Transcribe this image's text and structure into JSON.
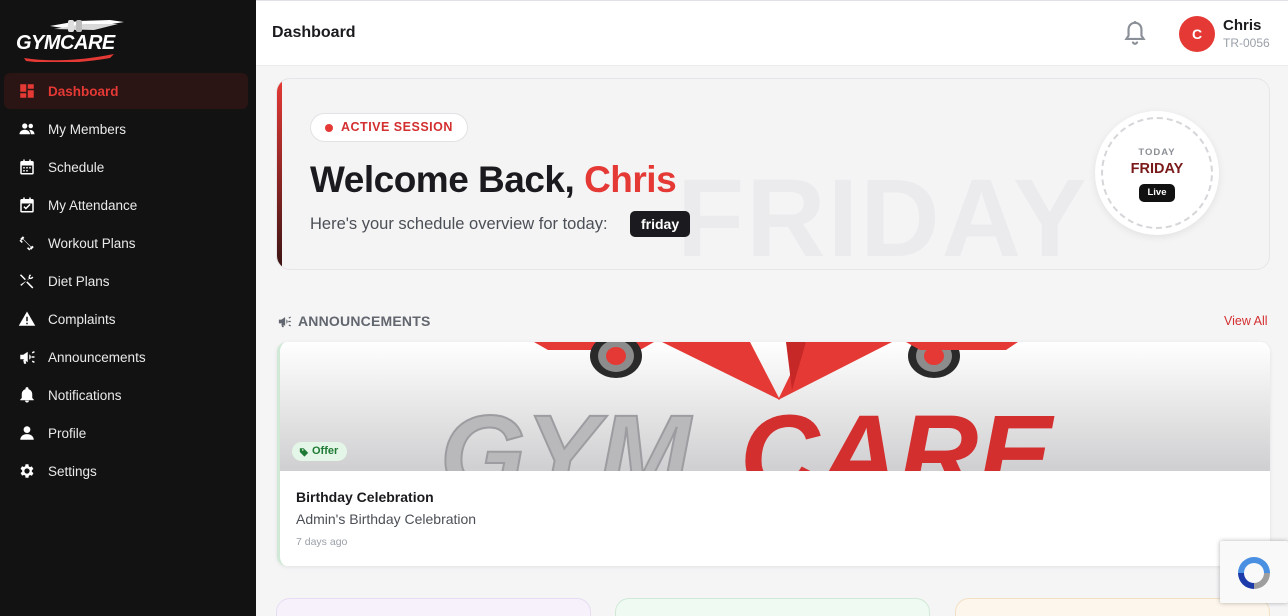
{
  "sidebar": {
    "logo_text": "GYMCARE",
    "items": [
      {
        "label": "Dashboard",
        "icon": "dashboard-icon",
        "active": true
      },
      {
        "label": "My Members",
        "icon": "members-icon"
      },
      {
        "label": "Schedule",
        "icon": "calendar-icon"
      },
      {
        "label": "My Attendance",
        "icon": "attendance-icon"
      },
      {
        "label": "Workout Plans",
        "icon": "dumbbell-icon"
      },
      {
        "label": "Diet Plans",
        "icon": "utensils-icon"
      },
      {
        "label": "Complaints",
        "icon": "warning-icon"
      },
      {
        "label": "Announcements",
        "icon": "megaphone-icon"
      },
      {
        "label": "Notifications",
        "icon": "bell-icon"
      },
      {
        "label": "Profile",
        "icon": "user-icon"
      },
      {
        "label": "Settings",
        "icon": "gear-icon"
      }
    ]
  },
  "header": {
    "title": "Dashboard",
    "user": {
      "initial": "C",
      "name": "Chris",
      "id": "TR-0056"
    }
  },
  "welcome": {
    "session_label": "ACTIVE SESSION",
    "greeting": "Welcome Back, ",
    "name": "Chris",
    "overview_text": "Here's your schedule overview for today:",
    "day_chip": "friday",
    "background_word": "FRIDAY",
    "today_label": "TODAY",
    "today_day": "FRIDAY",
    "live_label": "Live"
  },
  "announcements": {
    "heading": "ANNOUNCEMENTS",
    "view_all": "View All",
    "items": [
      {
        "badge": "Offer",
        "title": "Birthday Celebration",
        "description": "Admin's Birthday Celebration",
        "time": "7 days ago",
        "banner_text": "GYMCARE"
      }
    ]
  },
  "colors": {
    "accent": "#e53935",
    "sidebar_bg": "#121212",
    "offer_bg": "#e4f6e7",
    "offer_text": "#1f7a35"
  }
}
